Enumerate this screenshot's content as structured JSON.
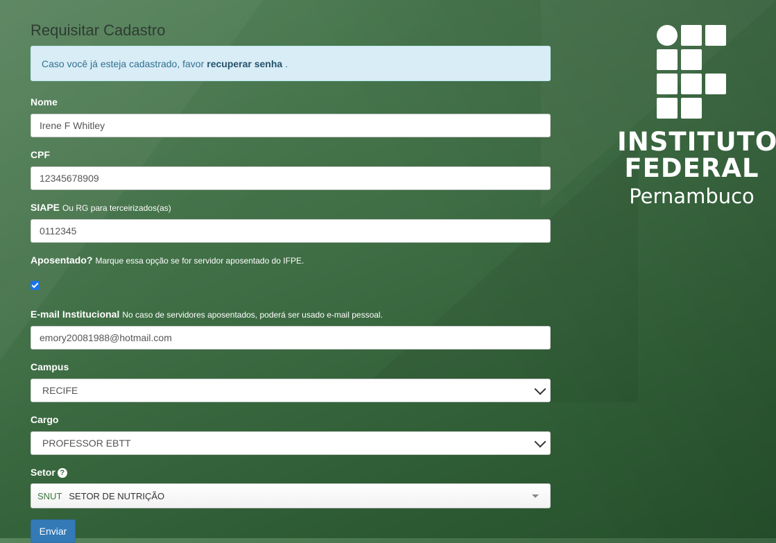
{
  "page": {
    "title": "Requisitar Cadastro"
  },
  "alert": {
    "text_before": "Caso você já esteja cadastrado, favor",
    "link": "recuperar senha",
    "text_after": "."
  },
  "fields": {
    "nome": {
      "label": "Nome",
      "value": "Irene F Whitley"
    },
    "cpf": {
      "label": "CPF",
      "value": "12345678909"
    },
    "siape": {
      "label": "SIAPE",
      "hint": "Ou RG para terceirizados(as)",
      "value": "0112345"
    },
    "aposentado": {
      "label": "Aposentado?",
      "hint": "Marque essa opção se for servidor aposentado do IFPE.",
      "checked": true
    },
    "email": {
      "label": "E-mail Institucional",
      "hint": "No caso de servidores aposentados, poderá ser usado e-mail pessoal.",
      "value": "emory20081988@hotmail.com"
    },
    "campus": {
      "label": "Campus",
      "selected": "RECIFE"
    },
    "cargo": {
      "label": "Cargo",
      "selected": "PROFESSOR EBTT"
    },
    "setor": {
      "label": "Setor",
      "code": "SNUT",
      "name": "SETOR DE NUTRIÇÃO",
      "help_icon": "question-circle-icon"
    }
  },
  "submit": {
    "label": "Enviar"
  },
  "logo": {
    "line1": "INSTITUTO",
    "line2": "FEDERAL",
    "line3": "Pernambuco"
  },
  "colors": {
    "primary": "#337ab7",
    "alert_bg": "#d9edf7",
    "alert_text": "#31708f",
    "background": "#3f6e45"
  }
}
